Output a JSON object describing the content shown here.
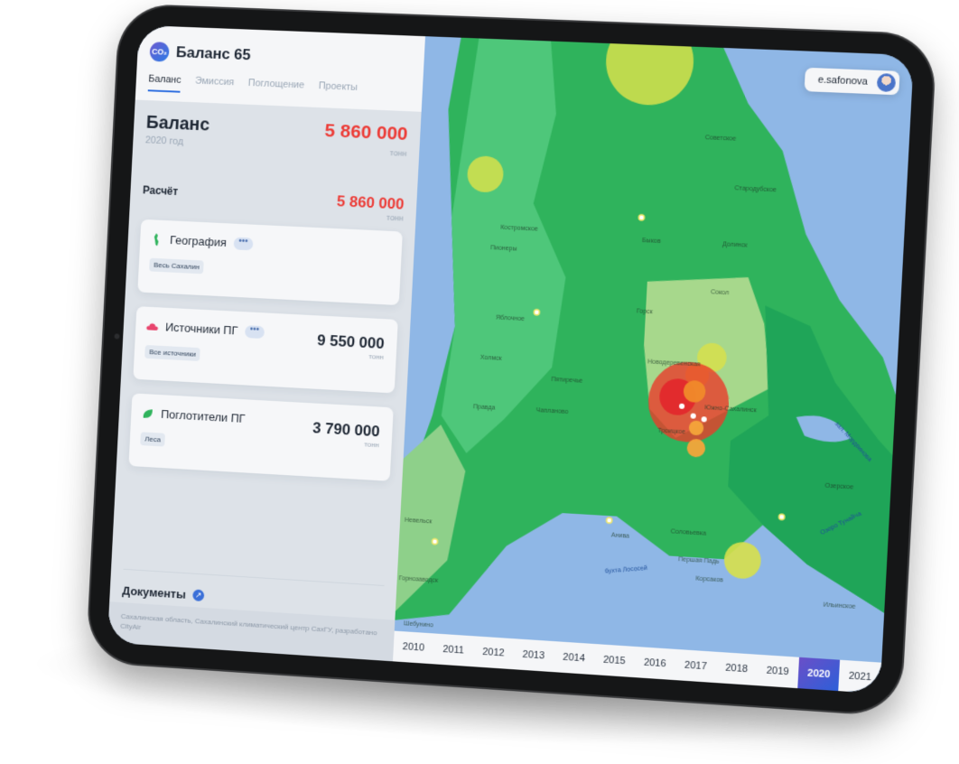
{
  "app": {
    "title": "Баланс 65",
    "logo_text": "CO₂"
  },
  "tabs": [
    {
      "label": "Баланс",
      "active": true
    },
    {
      "label": "Эмиссия",
      "active": false
    },
    {
      "label": "Поглощение",
      "active": false
    },
    {
      "label": "Проекты",
      "active": false
    }
  ],
  "balance": {
    "title": "Баланс",
    "year": "2020 год",
    "value": "5 860 000",
    "unit": "тонн"
  },
  "calculation": {
    "label": "Расчёт",
    "value": "5 860 000",
    "unit": "тонн"
  },
  "cards": {
    "geography": {
      "title": "География",
      "chip": "Весь Сахалин",
      "more": "•••"
    },
    "sources": {
      "title": "Источники ПГ",
      "chip": "Все источники",
      "value": "9 550 000",
      "unit": "тонн",
      "more": "•••"
    },
    "sinks": {
      "title": "Поглотители ПГ",
      "chip": "Леса",
      "value": "3 790 000",
      "unit": "тонн"
    }
  },
  "documents": {
    "label": "Документы",
    "arrow": "↗"
  },
  "footer": {
    "text": "Сахалинская область, Сахалинский климатический центр СахГУ, разработано CityAir"
  },
  "user": {
    "name": "e.safonova"
  },
  "years": [
    "2010",
    "2011",
    "2012",
    "2013",
    "2014",
    "2015",
    "2016",
    "2017",
    "2018",
    "2019",
    "2020",
    "2021"
  ],
  "selected_year": "2020",
  "map": {
    "towns": [
      "Советское",
      "Стародубское",
      "Быков",
      "Долинск",
      "Костромское",
      "Пионеры",
      "Сокол",
      "Горск",
      "Яблочное",
      "Новодеревенская",
      "Холмск",
      "Пятиречье",
      "Правда",
      "Чапланово",
      "Южно-Сахалинск",
      "Троицкое",
      "Невельск",
      "Анива",
      "Соловьевка",
      "Першая Падь",
      "Корсаков",
      "Озерское",
      "Ильинское",
      "Шебунино",
      "Горнозаводск"
    ],
    "water": [
      "зал. Мордвинова",
      "Озеро Тунайча",
      "бухта Лососей"
    ]
  },
  "colors": {
    "accent": "#2f6fe0",
    "negative": "#ec3b36",
    "forest": "#2fb35c",
    "water": "#8fb7e6"
  }
}
